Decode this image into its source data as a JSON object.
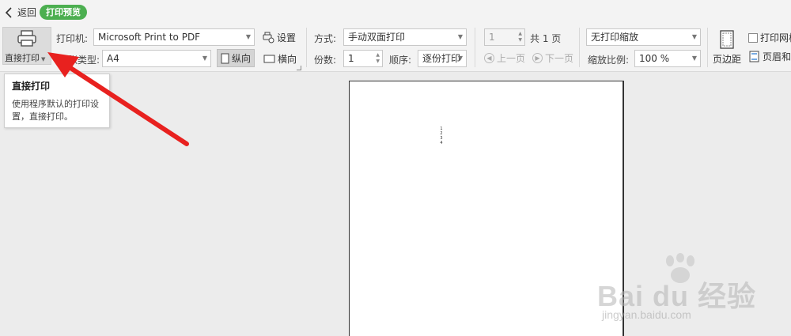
{
  "topbar": {
    "back_label": "返回",
    "mode_badge": "打印预览"
  },
  "ribbon": {
    "direct_print_label": "直接打印",
    "printer_label": "打印机:",
    "printer_value": "Microsoft Print to PDF",
    "settings_label": "设置",
    "paper_type_label": "纸张类型:",
    "paper_type_visible": "张类型:",
    "paper_value": "A4",
    "portrait_label": "纵向",
    "landscape_label": "横向",
    "mode_label": "方式:",
    "mode_value": "手动双面打印",
    "copies_label": "份数:",
    "copies_value": "1",
    "order_label": "顺序:",
    "order_value": "逐份打印",
    "page_value": "1",
    "total_pages": "共 1 页",
    "prev_page": "上一页",
    "next_page": "下一页",
    "scale_mode_value": "无打印缩放",
    "zoom_label": "缩放比例:",
    "zoom_value": "100 %",
    "margins_label": "页边距",
    "print_grid_label": "打印网格",
    "header_footer_label": "页眉和页脚"
  },
  "tooltip": {
    "title": "直接打印",
    "desc_line1": "使用程序默认的打印设",
    "desc_line2": "置，直接打印。"
  },
  "document": {
    "lines": [
      "1",
      "2",
      "3",
      "4"
    ]
  },
  "watermark": {
    "brand": "Bai du 经验",
    "url": "jingyan.baidu.com"
  },
  "colors": {
    "badge": "#4caf50",
    "arrow": "#e8211f"
  }
}
